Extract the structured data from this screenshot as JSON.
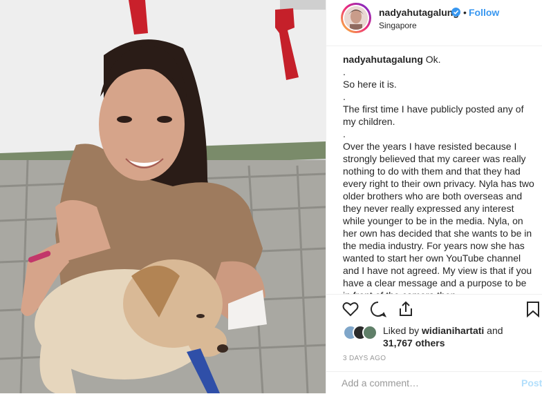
{
  "header": {
    "username": "nadyahutagalung",
    "verified_icon": "verified-badge-icon",
    "separator": "•",
    "follow_label": "Follow",
    "location": "Singapore"
  },
  "caption": {
    "username": "nadyahutagalung",
    "lines": [
      "Ok.",
      ".",
      "So here it is.",
      ".",
      "The first time I have publicly posted any of my children.",
      ".",
      "Over the years I have resisted because I strongly believed that my career was really nothing to do with them and that they had every right to their own privacy. Nyla has two older brothers who are both overseas and they never really expressed any interest while younger to be in the media. Nyla, on her own has decided that she wants to be in the media industry. For years now she has wanted to start her own YouTube channel and I have not agreed. My view is that if you have a clear message and a purpose to be in front of the camera then"
    ]
  },
  "actions": {
    "like_icon": "heart-icon",
    "comment_icon": "comment-icon",
    "share_icon": "share-icon",
    "save_icon": "bookmark-icon"
  },
  "likes": {
    "prefix": "Liked by",
    "user": "widianihartati",
    "conj": "and",
    "count": "31,767 others"
  },
  "timestamp": "3 DAYS AGO",
  "comment": {
    "placeholder": "Add a comment…",
    "post_label": "Post"
  },
  "colors": {
    "accent": "#3897f0",
    "text": "#262626",
    "muted": "#999999",
    "post_disabled": "#b2dffc"
  }
}
